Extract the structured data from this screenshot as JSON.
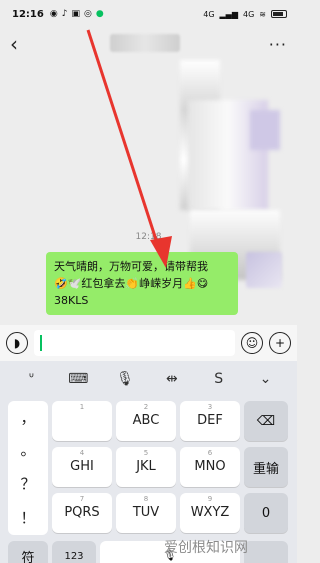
{
  "status": {
    "time": "12:16",
    "app_icons": [
      "◉",
      "♪",
      "▣",
      "◎",
      "●"
    ],
    "net1": "4G",
    "net2": "4G",
    "battery": ""
  },
  "chat": {
    "timestamp": "12:18",
    "message_lines": [
      "天气晴朗，万物可爱，请带帮我",
      "🤣🕊️红包拿去👏峥嵘岁月👍😋",
      "38KLS"
    ]
  },
  "keyboard": {
    "toolbar_icons": [
      "emoji-face",
      "keyboard",
      "microphone",
      "cursor",
      "switch"
    ],
    "punctuation": [
      "，",
      "。",
      "？",
      "！"
    ],
    "rows": [
      [
        {
          "sub": "1",
          "main": ""
        },
        {
          "sub": "2",
          "main": "ABC"
        },
        {
          "sub": "3",
          "main": "DEF"
        }
      ],
      [
        {
          "sub": "4",
          "main": "GHI"
        },
        {
          "sub": "5",
          "main": "JKL"
        },
        {
          "sub": "6",
          "main": "MNO"
        }
      ],
      [
        {
          "sub": "7",
          "main": "PQRS"
        },
        {
          "sub": "8",
          "main": "TUV"
        },
        {
          "sub": "9",
          "main": "WXYZ"
        }
      ]
    ],
    "reenter_label": "重输",
    "zero_label": "0",
    "symbol_label": "符",
    "num_label": "123"
  },
  "watermark": "爱创根知识网"
}
